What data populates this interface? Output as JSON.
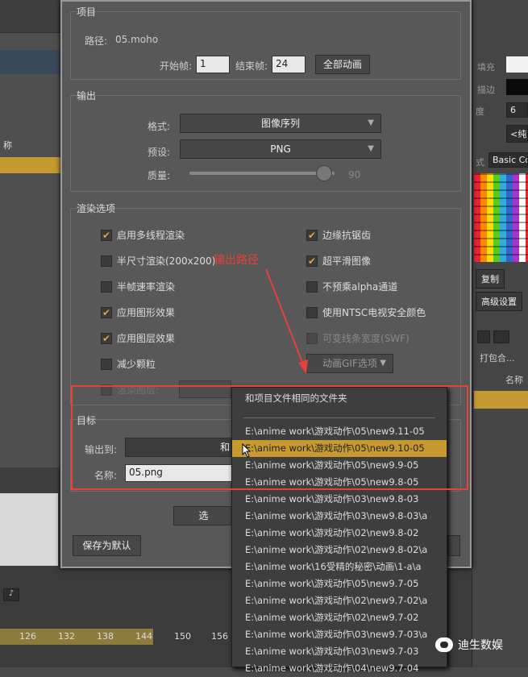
{
  "dialog": {
    "project": {
      "title": "项目",
      "path_label": "路径:",
      "path_value": "05.moho",
      "start_label": "开始帧:",
      "start_value": "1",
      "end_label": "结束帧:",
      "end_value": "24",
      "all_anim_button": "全部动画"
    },
    "output": {
      "title": "输出",
      "format_label": "格式:",
      "format_value": "图像序列",
      "preset_label": "预设:",
      "preset_value": "PNG",
      "quality_label": "质量:",
      "quality_value": "90"
    },
    "render": {
      "title": "渲染选项",
      "left": [
        {
          "label": "启用多线程渲染",
          "checked": true
        },
        {
          "label": "半尺寸渲染(200x200)",
          "checked": false
        },
        {
          "label": "半帧速率渲染",
          "checked": false
        },
        {
          "label": "应用图形效果",
          "checked": true
        },
        {
          "label": "应用图层效果",
          "checked": true
        },
        {
          "label": "减少颗粒",
          "checked": false
        },
        {
          "label": "渲染图层:",
          "checked": false
        }
      ],
      "right": [
        {
          "label": "边缘抗锯齿",
          "checked": true
        },
        {
          "label": "超平滑图像",
          "checked": true
        },
        {
          "label": "不预乘alpha通道",
          "checked": false
        },
        {
          "label": "使用NTSC电视安全颜色",
          "checked": false
        },
        {
          "label": "可变线条宽度(SWF)",
          "checked": false
        }
      ],
      "gif_button": "动画GIF选项"
    },
    "target": {
      "title": "目标",
      "output_label": "输出到:",
      "output_value": "和",
      "name_label": "名称:",
      "name_value": "05.png"
    },
    "partial_button": "选",
    "save_default_button": "保存为默认"
  },
  "dropdown": {
    "items": [
      "和项目文件相同的文件夹",
      "E:\\anime work\\游戏动作\\05\\new9.11-05",
      "E:\\anime work\\游戏动作\\05\\new9.10-05",
      "E:\\anime work\\游戏动作\\05\\new9.9-05",
      "E:\\anime work\\游戏动作\\05\\new9.8-05",
      "E:\\anime work\\游戏动作\\03\\new9.8-03",
      "E:\\anime work\\游戏动作\\03\\new9.8-03\\a",
      "E:\\anime work\\游戏动作\\02\\new9.8-02",
      "E:\\anime work\\游戏动作\\02\\new9.8-02\\a",
      "E:\\anime work\\16受精的秘密\\动画\\1-a\\a",
      "E:\\anime work\\游戏动作\\05\\new9.7-05",
      "E:\\anime work\\游戏动作\\02\\new9.7-02\\a",
      "E:\\anime work\\游戏动作\\02\\new9.7-02",
      "E:\\anime work\\游戏动作\\03\\new9.7-03\\a",
      "E:\\anime work\\游戏动作\\03\\new9.7-03",
      "E:\\anime work\\游戏动作\\04\\new9.7-04"
    ],
    "selected_index": 2
  },
  "annotation": {
    "text": "输出路径",
    "color": "#e8403a"
  },
  "background": {
    "left_label": "称",
    "ruler": [
      "126",
      "132",
      "138",
      "144",
      "150",
      "156"
    ],
    "right": {
      "fill_label": "填充",
      "stroke_label": "描边",
      "width_value": "6",
      "label_short": "度",
      "blend_value": "<纯色",
      "style_value": "Basic Co",
      "style_label": "式",
      "copy_button": "复制",
      "advanced_button": "高级设置",
      "pkg_label": "打包合...",
      "name_label": "名称"
    }
  },
  "watermark": {
    "text": "迪生数娱"
  },
  "colors": {
    "accent": "#c79a2f",
    "annotation": "#e8403a",
    "dialog_bg": "#585858"
  }
}
